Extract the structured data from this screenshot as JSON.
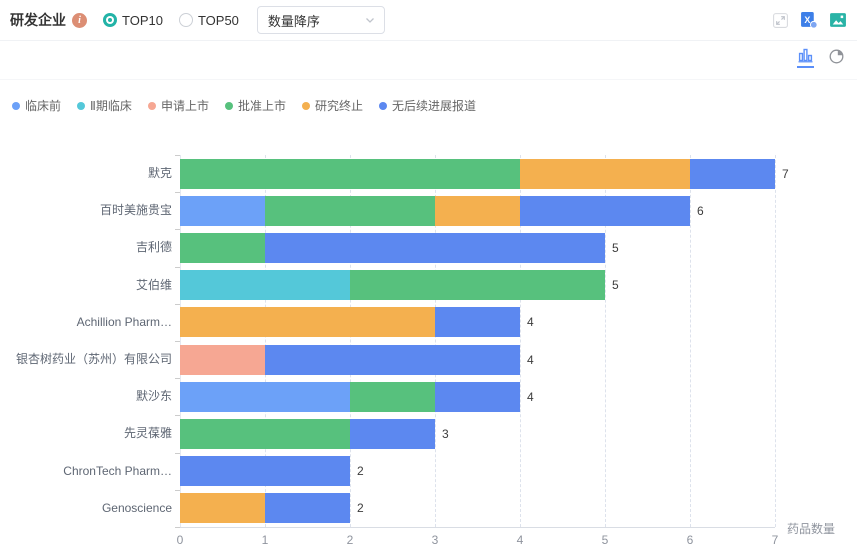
{
  "header": {
    "title": "研发企业",
    "info_glyph": "i",
    "radios": [
      {
        "label": "TOP10",
        "selected": true
      },
      {
        "label": "TOP50",
        "selected": false
      }
    ],
    "sort_dropdown": {
      "value": "数量降序"
    },
    "action_icons": [
      "expand-icon",
      "export-excel-icon",
      "export-image-icon"
    ]
  },
  "chart_toolbar": {
    "active_type": "bar",
    "icons": [
      "bar-chart-icon",
      "pie-chart-icon"
    ]
  },
  "colors": {
    "accent_teal": "#23B3A7",
    "toolbar_active_blue": "#5B8FF9",
    "info_icon_bg": "#DC8E74",
    "axis_text": "#8F949E",
    "label_text": "#5E6673",
    "legend_text": "#666666",
    "value_text": "#3c3c3c"
  },
  "chart_data": {
    "type": "bar",
    "orientation": "horizontal",
    "stacked": true,
    "title": "",
    "xlabel": "药品数量",
    "ylabel": "",
    "xlim": [
      0,
      7
    ],
    "xticks": [
      0,
      1,
      2,
      3,
      4,
      5,
      6,
      7
    ],
    "grid": "dashed-vertical",
    "legend_position": "top-left",
    "categories": [
      "默克",
      "百时美施贵宝",
      "吉利德",
      "艾伯维",
      "Achillion Pharm…",
      "银杏树药业（苏州）有限公司",
      "默沙东",
      "先灵葆雅",
      "ChronTech Pharm…",
      "Genoscience"
    ],
    "series": [
      {
        "name": "临床前",
        "color": "#6CA1F8",
        "values": [
          0,
          1,
          0,
          0,
          0,
          0,
          2,
          0,
          0,
          0
        ]
      },
      {
        "name": "Ⅱ期临床",
        "color": "#54C8D9",
        "values": [
          0,
          0,
          0,
          2,
          0,
          0,
          0,
          0,
          0,
          0
        ]
      },
      {
        "name": "申请上市",
        "color": "#F6A793",
        "values": [
          0,
          0,
          0,
          0,
          0,
          1,
          0,
          0,
          0,
          0
        ]
      },
      {
        "name": "批准上市",
        "color": "#57C17D",
        "values": [
          4,
          2,
          1,
          3,
          0,
          0,
          1,
          2,
          0,
          0
        ]
      },
      {
        "name": "研究终止",
        "color": "#F4B04F",
        "values": [
          2,
          1,
          0,
          0,
          3,
          0,
          0,
          0,
          0,
          1
        ]
      },
      {
        "name": "无后续进展报道",
        "color": "#5C88F0",
        "values": [
          1,
          2,
          4,
          0,
          1,
          3,
          1,
          1,
          2,
          1
        ]
      }
    ],
    "totals": [
      7,
      6,
      5,
      5,
      4,
      4,
      4,
      3,
      2,
      2
    ]
  }
}
